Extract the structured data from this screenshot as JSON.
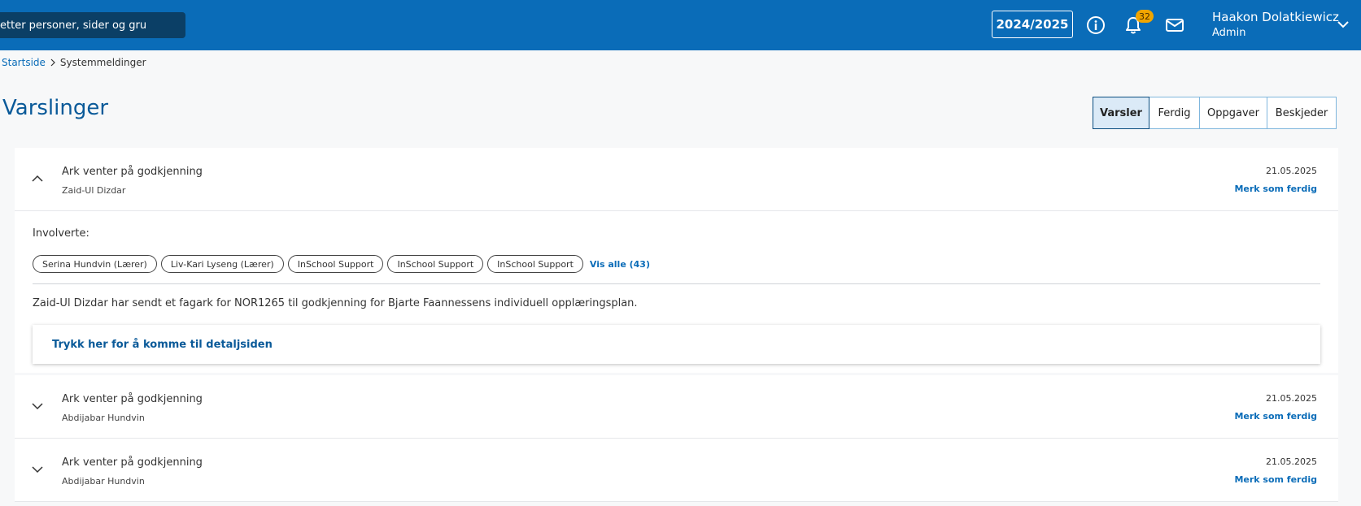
{
  "header": {
    "search_placeholder": "etter personer, sider og gru",
    "year": "2024/2025",
    "notification_count": "32",
    "user_name": "Haakon Dolatkiewicz",
    "user_role": "Admin"
  },
  "breadcrumb": {
    "home": "Startside",
    "current": "Systemmeldinger"
  },
  "page_title": "Varslinger",
  "tabs": [
    {
      "label": "Varsler",
      "active": true
    },
    {
      "label": "Ferdig",
      "active": false
    },
    {
      "label": "Oppgaver",
      "active": false
    },
    {
      "label": "Beskjeder",
      "active": false
    }
  ],
  "items": [
    {
      "title": "Ark venter på godkjenning",
      "sender": "Zaid-Ul Dizdar",
      "date": "21.05.2025",
      "mark_label": "Merk som ferdig",
      "expanded": true,
      "involved_label": "Involverte:",
      "involved": [
        "Serina Hundvin (Lærer)",
        "Liv-Kari Lyseng (Lærer)",
        "InSchool Support",
        "InSchool Support",
        "InSchool Support"
      ],
      "show_all": "Vis alle (43)",
      "message": "Zaid-Ul Dizdar har sendt et fagark for NOR1265 til godkjenning for Bjarte Faannessens individuell opplæringsplan.",
      "detail_link": "Trykk her for å komme til detaljsiden"
    },
    {
      "title": "Ark venter på godkjenning",
      "sender": "Abdijabar Hundvin",
      "date": "21.05.2025",
      "mark_label": "Merk som ferdig",
      "expanded": false
    },
    {
      "title": "Ark venter på godkjenning",
      "sender": "Abdijabar Hundvin",
      "date": "21.05.2025",
      "mark_label": "Merk som ferdig",
      "expanded": false
    }
  ],
  "colors": {
    "topbar": "#0a6cb8",
    "search_bg": "#0b3f66",
    "badge": "#f0a500",
    "link": "#0a6cb8"
  }
}
